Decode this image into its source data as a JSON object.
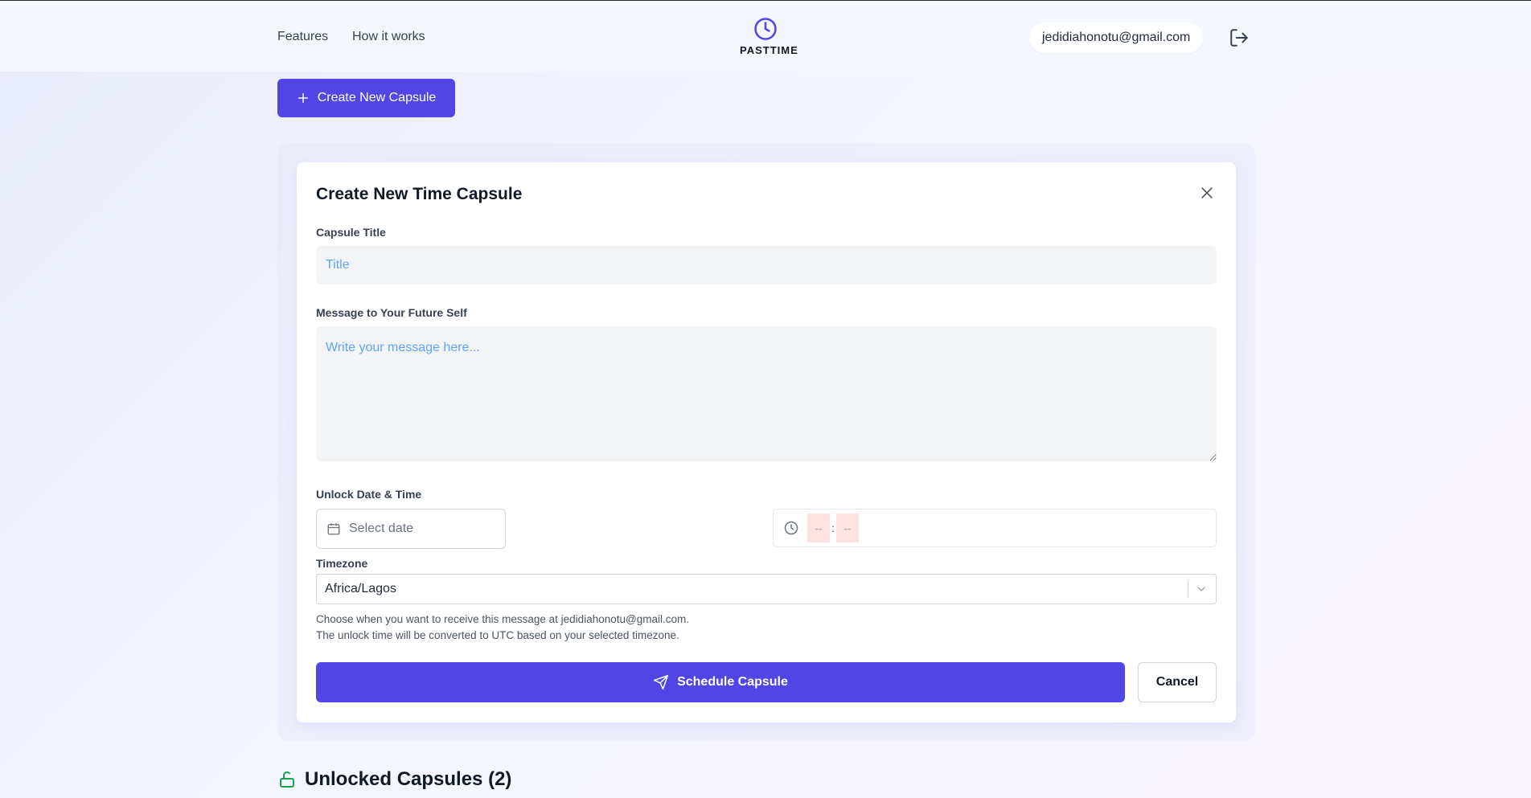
{
  "header": {
    "nav": [
      "Features",
      "How it works"
    ],
    "logo_text": "PASTTIME",
    "user_email": "jedidiahonotu@gmail.com"
  },
  "create_button_label": "Create New Capsule",
  "modal": {
    "title": "Create New Time Capsule",
    "capsule_title_label": "Capsule Title",
    "capsule_title_placeholder": "Title",
    "message_label": "Message to Your Future Self",
    "message_placeholder": "Write your message here...",
    "unlock_label": "Unlock Date & Time",
    "date_placeholder": "Select date",
    "time_hour": "--",
    "time_minute": "--",
    "time_separator": ":",
    "timezone_label": "Timezone",
    "timezone_value": "Africa/Lagos",
    "help_line1": "Choose when you want to receive this message at jedidiahonotu@gmail.com.",
    "help_line2": "The unlock time will be converted to UTC based on your selected timezone.",
    "schedule_label": "Schedule Capsule",
    "cancel_label": "Cancel"
  },
  "unlocked_heading": "Unlocked Capsules (2)",
  "colors": {
    "accent": "#4f46e5",
    "success": "#16a34a",
    "placeholder": "#60a5fa"
  }
}
